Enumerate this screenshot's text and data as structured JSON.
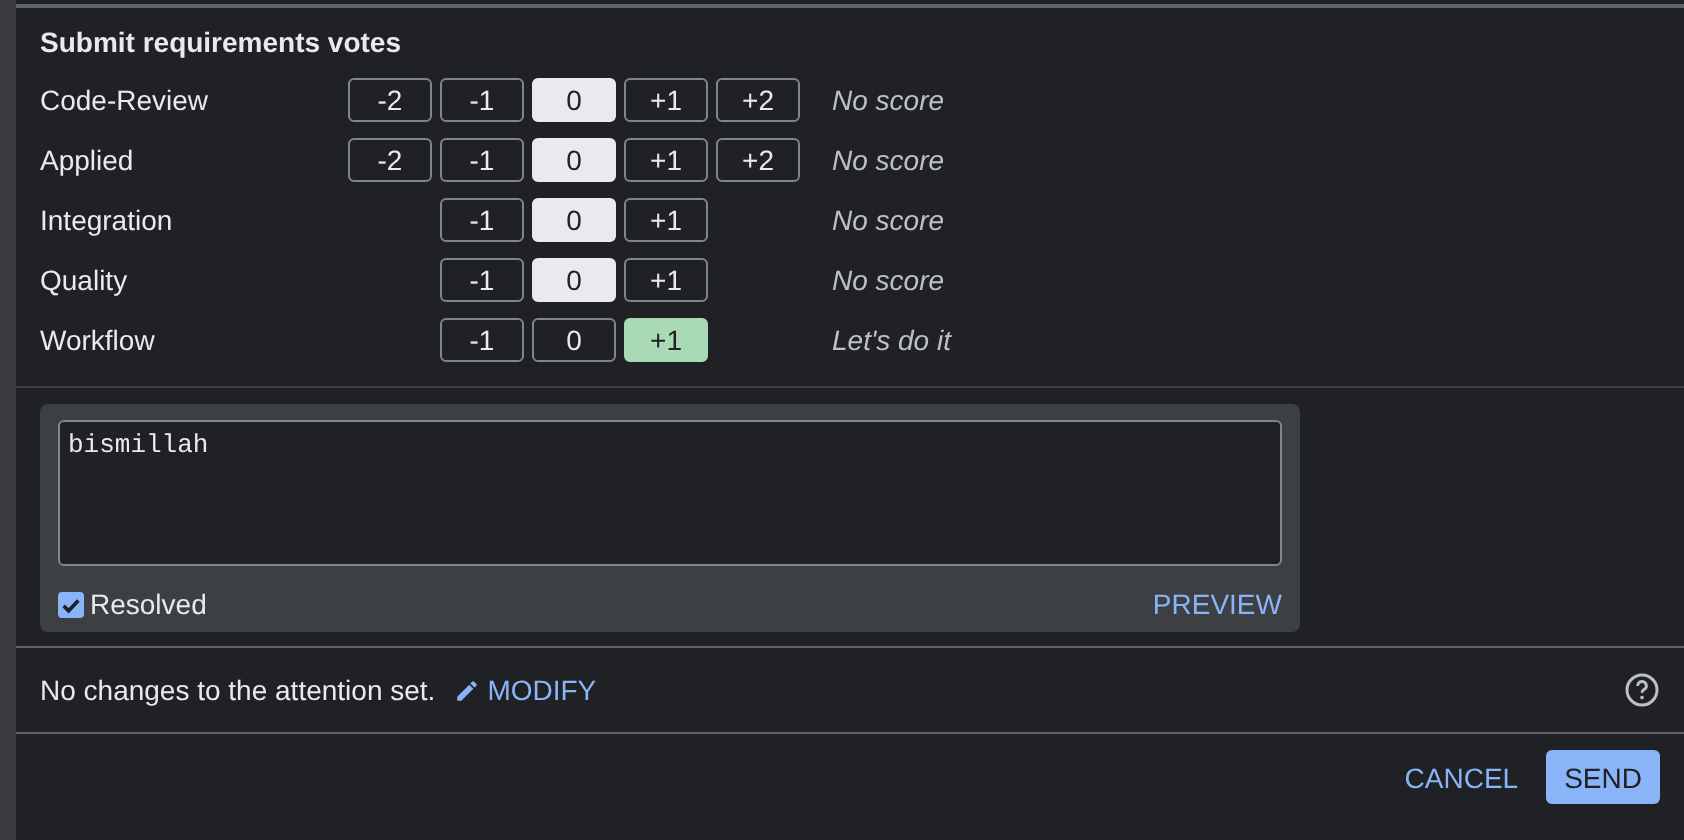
{
  "section_title": "Submit requirements votes",
  "labels": [
    {
      "name": "Code-Review",
      "color": "#e8eaed",
      "votes": [
        {
          "value": "-2",
          "selected": false
        },
        {
          "value": "-1",
          "selected": false
        },
        {
          "value": "0",
          "selected": true
        },
        {
          "value": "+1",
          "selected": false
        },
        {
          "value": "+2",
          "selected": false
        }
      ],
      "status": "No score"
    },
    {
      "name": "Applied",
      "color": "#e8eaed",
      "votes": [
        {
          "value": "-2",
          "selected": false
        },
        {
          "value": "-1",
          "selected": false
        },
        {
          "value": "0",
          "selected": true
        },
        {
          "value": "+1",
          "selected": false
        },
        {
          "value": "+2",
          "selected": false
        }
      ],
      "status": "No score"
    },
    {
      "name": "Integration",
      "color": "#e8eaed",
      "votes": [
        {
          "value": "-1",
          "selected": false
        },
        {
          "value": "0",
          "selected": true
        },
        {
          "value": "+1",
          "selected": false
        }
      ],
      "status": "No score"
    },
    {
      "name": "Quality",
      "color": "#e8eaed",
      "votes": [
        {
          "value": "-1",
          "selected": false
        },
        {
          "value": "0",
          "selected": true
        },
        {
          "value": "+1",
          "selected": false
        }
      ],
      "status": "No score"
    },
    {
      "name": "Workflow",
      "color": "#a8dab5",
      "votes": [
        {
          "value": "-1",
          "selected": false
        },
        {
          "value": "0",
          "selected": false
        },
        {
          "value": "+1",
          "selected": true
        }
      ],
      "status": "Let's do it"
    }
  ],
  "comment": {
    "value": "bismillah",
    "resolved": {
      "label": "Resolved",
      "checked": true
    },
    "preview": "PREVIEW"
  },
  "attention": {
    "text": "No changes to the attention set.",
    "modify": "MODIFY"
  },
  "buttons": {
    "cancel": "CANCEL",
    "send": "SEND"
  }
}
